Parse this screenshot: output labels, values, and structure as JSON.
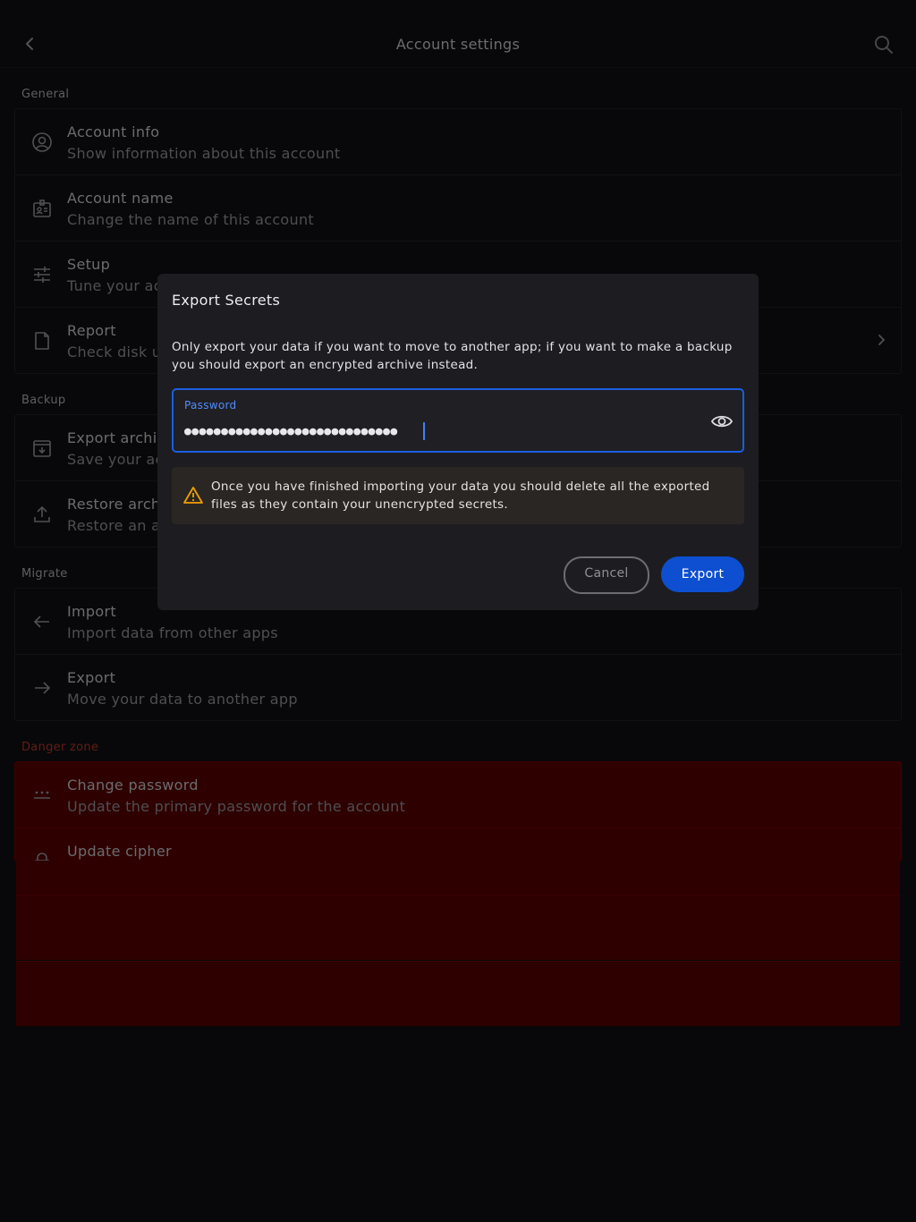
{
  "header": {
    "title": "Account settings",
    "back_icon": "chevron-left-icon",
    "search_icon": "search-icon"
  },
  "sections": {
    "general": {
      "title": "General",
      "items": [
        {
          "name": "Account info",
          "desc": "Show information about this account",
          "icon": "user-circle-icon"
        },
        {
          "name": "Account name",
          "desc": "Change the name of this account",
          "icon": "id-badge-icon"
        },
        {
          "name": "Setup",
          "desc": "Tune your ac",
          "icon": "sliders-icon"
        },
        {
          "name": "Report",
          "desc": "Check disk u",
          "icon": "document-icon"
        }
      ]
    },
    "backup": {
      "title": "Backup",
      "items": [
        {
          "name": "Export archiv",
          "desc": "Save your ac",
          "icon": "archive-download-icon"
        },
        {
          "name": "Restore arch",
          "desc": "Restore an ac",
          "icon": "upload-icon"
        }
      ]
    },
    "migrate": {
      "title": "Migrate",
      "items": [
        {
          "name": "Import",
          "desc": "Import data from other apps",
          "icon": "arrow-left-icon"
        },
        {
          "name": "Export",
          "desc": "Move your data to another app",
          "icon": "arrow-right-icon"
        }
      ]
    },
    "danger": {
      "title": "Danger zone",
      "items": [
        {
          "name": "Change password",
          "desc": "Update the primary password for the account",
          "icon": "password-dots-icon"
        },
        {
          "name": "Update cipher",
          "desc": "",
          "icon": "lock-icon"
        }
      ]
    }
  },
  "dialog": {
    "title": "Export Secrets",
    "body": "Only export your data if you want to move to another app; if you want to make a backup you should export an encrypted archive instead.",
    "password_label": "Password",
    "password_value": "●●●●●●●●●●●●●●●●●●●●●●●●●●●●●",
    "warning": "Once you have finished importing your data you should delete all the exported files as they contain your unencrypted secrets.",
    "cancel_label": "Cancel",
    "export_label": "Export"
  },
  "colors": {
    "background": "#111114",
    "accent": "#0d4fd0",
    "danger": "#5c0000",
    "warning": "#f0a000"
  }
}
